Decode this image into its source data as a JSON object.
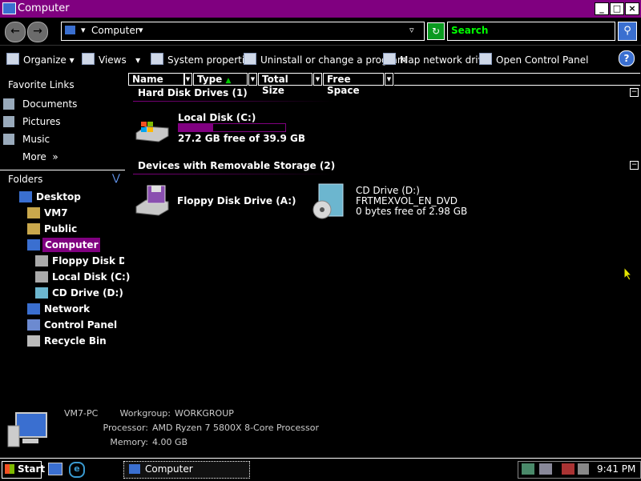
{
  "window": {
    "title": "Computer",
    "minimize": "_",
    "maximize": "□",
    "close": "×"
  },
  "address": {
    "path": "Computer",
    "search_placeholder": "Search"
  },
  "toolbar": {
    "organize": "Organize",
    "views": "Views",
    "system_properties": "System properties",
    "uninstall": "Uninstall or change a program",
    "map_drive": "Map network drive",
    "control_panel": "Open Control Panel"
  },
  "favorites": {
    "header": "Favorite Links",
    "items": [
      "Documents",
      "Pictures",
      "Music"
    ],
    "more": "More"
  },
  "folders": {
    "header": "Folders",
    "tree": [
      "Desktop",
      "VM7",
      "Public",
      "Computer",
      "Floppy Disk Driv",
      "Local Disk (C:)",
      "CD Drive (D:) Fl",
      "Network",
      "Control Panel",
      "Recycle Bin"
    ]
  },
  "columns": [
    "Name",
    "Type",
    "Total Size",
    "Free Space"
  ],
  "groups": {
    "hdd": "Hard Disk Drives (1)",
    "removable": "Devices with Removable Storage (2)"
  },
  "drives": {
    "c_name": "Local Disk (C:)",
    "c_free": "27.2 GB free of 39.9 GB",
    "c_used_fraction": 0.32,
    "a_name": "Floppy Disk Drive (A:)",
    "d_name": "CD Drive (D:)",
    "d_label": "FRTMEXVOL_EN_DVD",
    "d_free": "0 bytes free of 2.98 GB"
  },
  "details": {
    "pc": "VM7-PC",
    "workgroup_label": "Workgroup:",
    "workgroup": "WORKGROUP",
    "processor_label": "Processor:",
    "processor": "AMD Ryzen 7 5800X 8-Core Processor",
    "memory_label": "Memory:",
    "memory": "4.00 GB"
  },
  "taskbar": {
    "start": "Start",
    "window": "Computer",
    "clock": "9:41 PM"
  },
  "colors": {
    "accent": "#800080",
    "search_text": "#00ff00"
  }
}
